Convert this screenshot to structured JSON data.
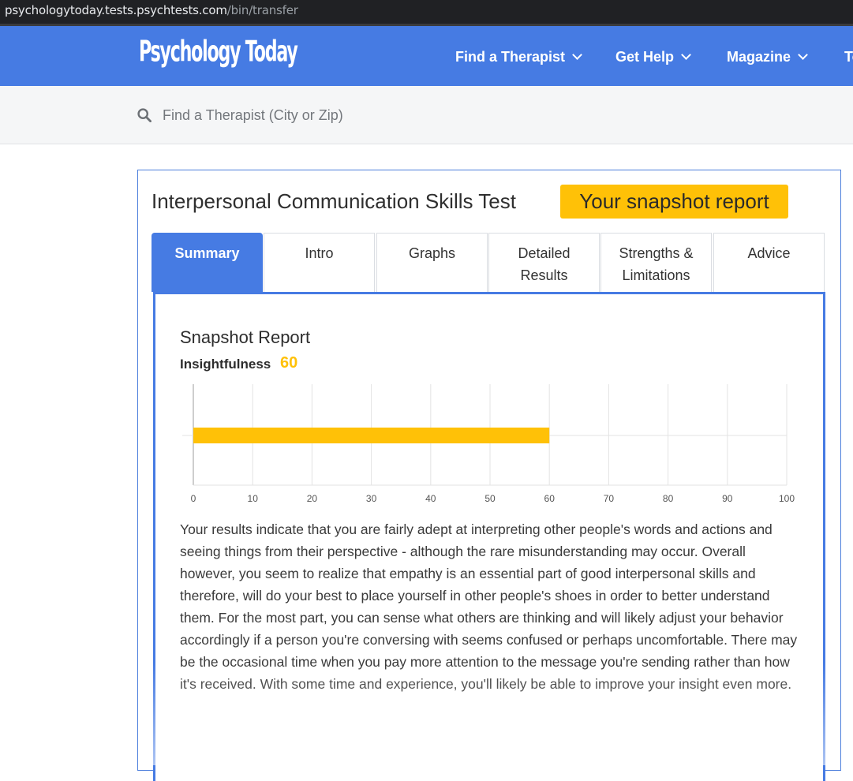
{
  "browser": {
    "url_host": "psychologytoday.tests.psychtests.com",
    "url_path": "/bin/transfer"
  },
  "nav": {
    "logo": "Psychology Today",
    "items": [
      {
        "label": "Find a Therapist"
      },
      {
        "label": "Get Help"
      },
      {
        "label": "Magazine"
      },
      {
        "label": "To"
      }
    ]
  },
  "search": {
    "placeholder": "Find a Therapist (City or Zip)",
    "icon": "search-icon"
  },
  "report": {
    "test_title": "Interpersonal Communication Skills Test",
    "badge": "Your snapshot report",
    "tabs": [
      {
        "label": "Summary",
        "active": true
      },
      {
        "label": "Intro"
      },
      {
        "label": "Graphs"
      },
      {
        "label": "Detailed Results"
      },
      {
        "label": "Strengths & Limitations"
      },
      {
        "label": "Advice"
      }
    ],
    "section_title": "Snapshot Report",
    "score_label": "Insightfulness",
    "score_value": "60",
    "summary_text": "Your results indicate that you are fairly adept at interpreting other people's words and actions and seeing things from their perspective - although the rare misunderstanding may occur. Overall however, you seem to realize that empathy is an essential part of good interpersonal skills and therefore, will do your best to place yourself in other people's shoes in order to better understand them. For the most part, you can sense what others are thinking and will likely adjust your behavior accordingly if a person you're conversing with seems confused or perhaps uncomfortable. There may be the occasional time when you pay more attention to the message you're sending rather than how it's received. With some time and experience, you'll likely be able to improve your insight even more."
  },
  "colors": {
    "brand_blue": "#467be3",
    "accent_yellow": "#ffc107"
  },
  "chart_data": {
    "type": "bar",
    "orientation": "horizontal",
    "categories": [
      "Insightfulness"
    ],
    "values": [
      60
    ],
    "xlim": [
      0,
      100
    ],
    "xticks": [
      "0",
      "10",
      "20",
      "30",
      "40",
      "50",
      "60",
      "70",
      "80",
      "90",
      "100"
    ],
    "grid": true,
    "bar_color": "#ffc107"
  }
}
